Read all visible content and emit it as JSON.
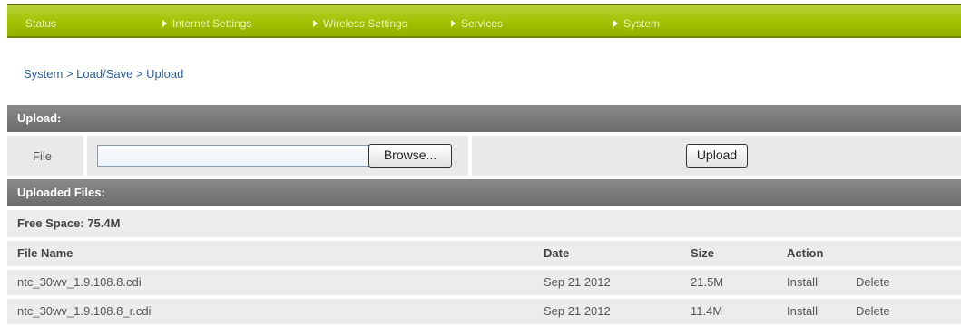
{
  "nav": {
    "status": "Status",
    "items": [
      "Internet Settings",
      "Wireless Settings",
      "Services",
      "System"
    ]
  },
  "breadcrumb": "System > Load/Save > Upload",
  "upload_section": {
    "title": "Upload:",
    "file_label": "File",
    "file_value": "",
    "browse_label": "Browse...",
    "upload_label": "Upload"
  },
  "uploaded_section": {
    "title": "Uploaded Files:",
    "free_space": "Free Space: 75.4M",
    "columns": [
      "File Name",
      "Date",
      "Size",
      "Action"
    ],
    "rows": [
      {
        "name": "ntc_30wv_1.9.108.8.cdi",
        "date": "Sep 21 2012",
        "size": "21.5M",
        "install": "Install",
        "delete": "Delete"
      },
      {
        "name": "ntc_30wv_1.9.108.8_r.cdi",
        "date": "Sep 21 2012",
        "size": "11.4M",
        "install": "Install",
        "delete": "Delete"
      }
    ]
  },
  "colors": {
    "nav_green": "#a2c100",
    "header_gray": "#7a7a7a",
    "link_blue": "#2866b8"
  }
}
